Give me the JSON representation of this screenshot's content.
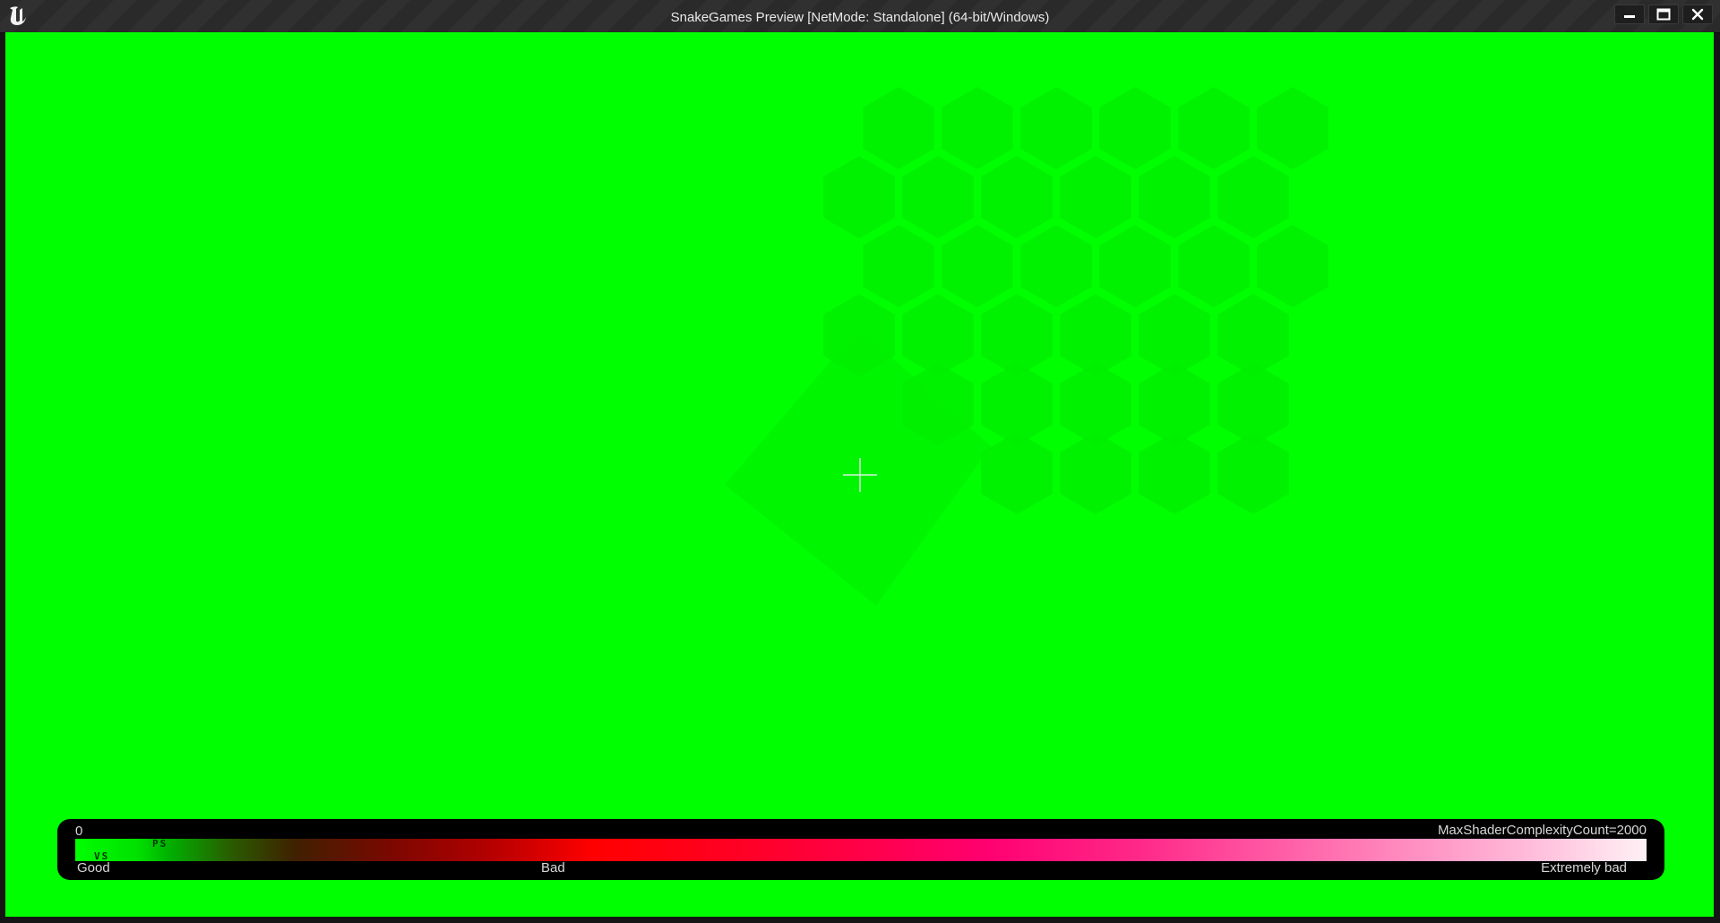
{
  "window": {
    "title": "SnakeGames Preview [NetMode: Standalone]  (64-bit/Windows)",
    "logo_icon": "unreal-engine-logo",
    "controls": [
      "minimize-icon",
      "maximize-icon",
      "close-icon"
    ]
  },
  "viewport": {
    "view_mode": "Shader Complexity",
    "background_color": "#00ff00",
    "crosshair_icon": "crosshair-icon"
  },
  "legend": {
    "min_value": "0",
    "max_label": "MaxShaderComplexityCount=2000",
    "label_good": "Good",
    "label_bad": "Bad",
    "label_extreme": "Extremely bad",
    "marker_ps": "PS",
    "marker_vs": "VS",
    "colors": [
      "#00ff00",
      "#7a0800",
      "#ff0000",
      "#ff0070",
      "#fff0f4"
    ]
  }
}
